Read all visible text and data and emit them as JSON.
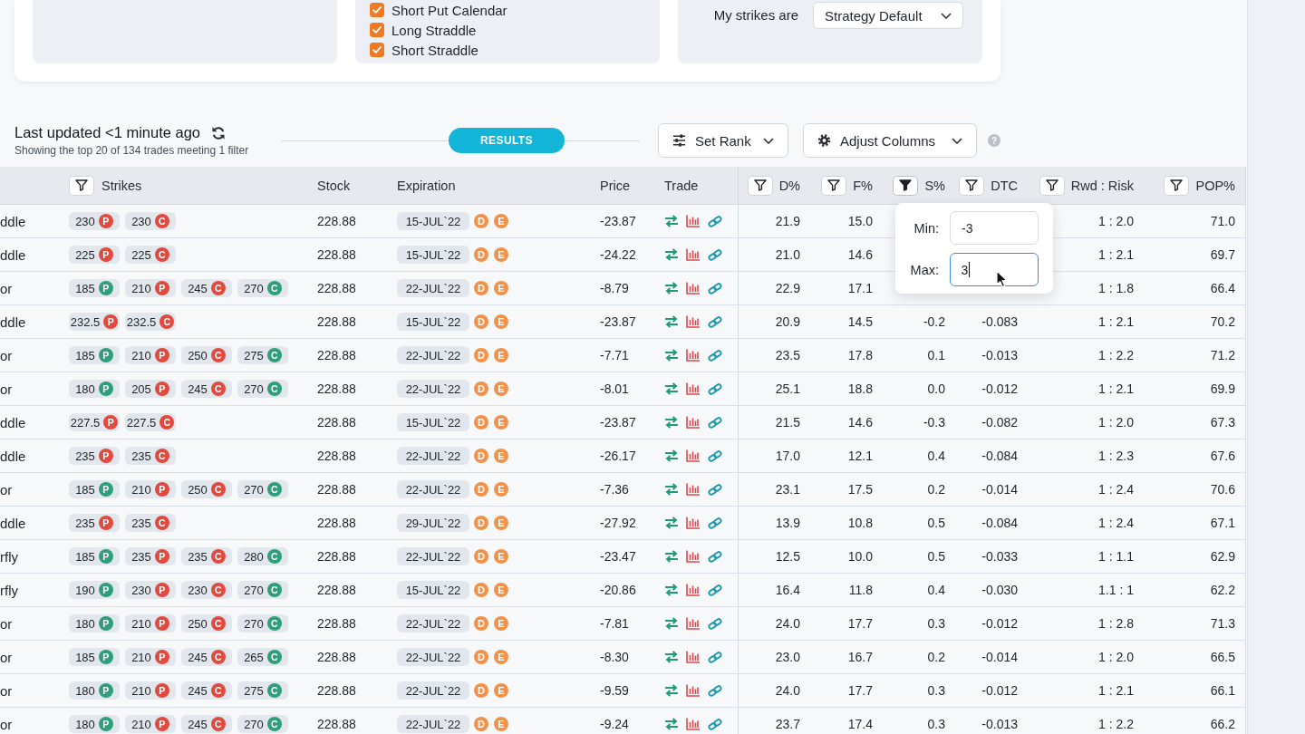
{
  "strategy_panel": {
    "cards": [
      {
        "kind": "blank"
      },
      {
        "kind": "checklist",
        "items": [
          {
            "label": "Short Put Calendar",
            "checked": true
          },
          {
            "label": "Long Straddle",
            "checked": true
          },
          {
            "label": "Short Straddle",
            "checked": true
          }
        ]
      },
      {
        "kind": "select",
        "label": "My strikes are",
        "value": "Strategy Default"
      }
    ]
  },
  "results_header": {
    "title": "Last updated <1 minute ago",
    "summary": "Showing the top 20 of 134 trades meeting 1 filter",
    "section_label": "RESULTS",
    "buttons": [
      {
        "kind": "rank",
        "label": "Set Rank"
      },
      {
        "kind": "columns",
        "label": "Adjust Columns"
      }
    ],
    "help": "?"
  },
  "table": {
    "columns": [
      {
        "label": "Strikes",
        "kind": "filterable",
        "filter_active": false
      },
      {
        "label": "Stock",
        "kind": "plain"
      },
      {
        "label": "Expiration",
        "kind": "plain"
      },
      {
        "label": "Price",
        "kind": "plain"
      },
      {
        "label": "Trade",
        "kind": "plain"
      },
      {
        "label": "D%",
        "kind": "filterable",
        "filter_active": false
      },
      {
        "label": "F%",
        "kind": "filterable",
        "filter_active": false
      },
      {
        "label": "S%",
        "kind": "filterable",
        "filter_active": true
      },
      {
        "label": "DTC",
        "kind": "filterable",
        "filter_active": false
      },
      {
        "label": "Rwd : Risk",
        "kind": "filterable",
        "filter_active": false
      },
      {
        "label": "POP%",
        "kind": "filterable",
        "filter_active": false
      }
    ],
    "rows": [
      {
        "strategy": "ddle",
        "strikes": [
          {
            "value": "230",
            "type": "P",
            "color": "#e04a3f"
          },
          {
            "value": "230",
            "type": "C",
            "color": "#e04a3f"
          }
        ],
        "stock": "228.88",
        "expiration": "15-JUL`22",
        "markers": [
          "D",
          "E"
        ],
        "price": "-23.87",
        "d_pct": "21.9",
        "f_pct": "15.0",
        "rwd_risk": "1 : 2.0",
        "pop_pct": "71.0"
      },
      {
        "strategy": "ddle",
        "strikes": [
          {
            "value": "225",
            "type": "P",
            "color": "#e04a3f"
          },
          {
            "value": "225",
            "type": "C",
            "color": "#e04a3f"
          }
        ],
        "stock": "228.88",
        "expiration": "15-JUL`22",
        "markers": [
          "D",
          "E"
        ],
        "price": "-24.22",
        "d_pct": "21.0",
        "f_pct": "14.6",
        "rwd_risk": "1 : 2.1",
        "pop_pct": "69.7"
      },
      {
        "strategy": "or",
        "strikes": [
          {
            "value": "185",
            "type": "P",
            "color": "#2f9e7b"
          },
          {
            "value": "210",
            "type": "P",
            "color": "#e04a3f"
          },
          {
            "value": "245",
            "type": "C",
            "color": "#e04a3f"
          },
          {
            "value": "270",
            "type": "C",
            "color": "#2f9e7b"
          }
        ],
        "stock": "228.88",
        "expiration": "22-JUL`22",
        "markers": [
          "D",
          "E"
        ],
        "price": "-8.79",
        "d_pct": "22.9",
        "f_pct": "17.1",
        "rwd_risk": "1 : 1.8",
        "pop_pct": "66.4"
      },
      {
        "strategy": "ddle",
        "strikes": [
          {
            "value": "232.5",
            "type": "P",
            "color": "#e04a3f"
          },
          {
            "value": "232.5",
            "type": "C",
            "color": "#e04a3f"
          }
        ],
        "stock": "228.88",
        "expiration": "15-JUL`22",
        "markers": [
          "D",
          "E"
        ],
        "price": "-23.87",
        "d_pct": "20.9",
        "f_pct": "14.5",
        "s_pct": "-0.2",
        "dtc": "-0.083",
        "rwd_risk": "1 : 2.1",
        "pop_pct": "70.2"
      },
      {
        "strategy": "or",
        "strikes": [
          {
            "value": "185",
            "type": "P",
            "color": "#2f9e7b"
          },
          {
            "value": "210",
            "type": "P",
            "color": "#e04a3f"
          },
          {
            "value": "250",
            "type": "C",
            "color": "#e04a3f"
          },
          {
            "value": "275",
            "type": "C",
            "color": "#2f9e7b"
          }
        ],
        "stock": "228.88",
        "expiration": "22-JUL`22",
        "markers": [
          "D",
          "E"
        ],
        "price": "-7.71",
        "d_pct": "23.5",
        "f_pct": "17.8",
        "s_pct": "0.1",
        "dtc": "-0.013",
        "rwd_risk": "1 : 2.2",
        "pop_pct": "71.2"
      },
      {
        "strategy": "or",
        "strikes": [
          {
            "value": "180",
            "type": "P",
            "color": "#2f9e7b"
          },
          {
            "value": "205",
            "type": "P",
            "color": "#e04a3f"
          },
          {
            "value": "245",
            "type": "C",
            "color": "#e04a3f"
          },
          {
            "value": "270",
            "type": "C",
            "color": "#2f9e7b"
          }
        ],
        "stock": "228.88",
        "expiration": "22-JUL`22",
        "markers": [
          "D",
          "E"
        ],
        "price": "-8.01",
        "d_pct": "25.1",
        "f_pct": "18.8",
        "s_pct": "0.0",
        "dtc": "-0.012",
        "rwd_risk": "1 : 2.1",
        "pop_pct": "69.9"
      },
      {
        "strategy": "ddle",
        "strikes": [
          {
            "value": "227.5",
            "type": "P",
            "color": "#e04a3f"
          },
          {
            "value": "227.5",
            "type": "C",
            "color": "#e04a3f"
          }
        ],
        "stock": "228.88",
        "expiration": "15-JUL`22",
        "markers": [
          "D",
          "E"
        ],
        "price": "-23.87",
        "d_pct": "21.5",
        "f_pct": "14.6",
        "s_pct": "-0.3",
        "dtc": "-0.082",
        "rwd_risk": "1 : 2.0",
        "pop_pct": "67.3"
      },
      {
        "strategy": "ddle",
        "strikes": [
          {
            "value": "235",
            "type": "P",
            "color": "#e04a3f"
          },
          {
            "value": "235",
            "type": "C",
            "color": "#e04a3f"
          }
        ],
        "stock": "228.88",
        "expiration": "22-JUL`22",
        "markers": [
          "D",
          "E"
        ],
        "price": "-26.17",
        "d_pct": "17.0",
        "f_pct": "12.1",
        "s_pct": "0.4",
        "dtc": "-0.084",
        "rwd_risk": "1 : 2.3",
        "pop_pct": "67.6"
      },
      {
        "strategy": "or",
        "strikes": [
          {
            "value": "185",
            "type": "P",
            "color": "#2f9e7b"
          },
          {
            "value": "210",
            "type": "P",
            "color": "#e04a3f"
          },
          {
            "value": "250",
            "type": "C",
            "color": "#e04a3f"
          },
          {
            "value": "270",
            "type": "C",
            "color": "#2f9e7b"
          }
        ],
        "stock": "228.88",
        "expiration": "22-JUL`22",
        "markers": [
          "D",
          "E"
        ],
        "price": "-7.36",
        "d_pct": "23.1",
        "f_pct": "17.5",
        "s_pct": "0.2",
        "dtc": "-0.014",
        "rwd_risk": "1 : 2.4",
        "pop_pct": "70.6"
      },
      {
        "strategy": "ddle",
        "strikes": [
          {
            "value": "235",
            "type": "P",
            "color": "#e04a3f"
          },
          {
            "value": "235",
            "type": "C",
            "color": "#e04a3f"
          }
        ],
        "stock": "228.88",
        "expiration": "29-JUL`22",
        "markers": [
          "D",
          "E"
        ],
        "price": "-27.92",
        "d_pct": "13.9",
        "f_pct": "10.8",
        "s_pct": "0.5",
        "dtc": "-0.084",
        "rwd_risk": "1 : 2.4",
        "pop_pct": "67.1"
      },
      {
        "strategy": "rfly",
        "strikes": [
          {
            "value": "185",
            "type": "P",
            "color": "#2f9e7b"
          },
          {
            "value": "235",
            "type": "P",
            "color": "#e04a3f"
          },
          {
            "value": "235",
            "type": "C",
            "color": "#e04a3f"
          },
          {
            "value": "280",
            "type": "C",
            "color": "#2f9e7b"
          }
        ],
        "stock": "228.88",
        "expiration": "22-JUL`22",
        "markers": [
          "D",
          "E"
        ],
        "price": "-23.47",
        "d_pct": "12.5",
        "f_pct": "10.0",
        "s_pct": "0.5",
        "dtc": "-0.033",
        "rwd_risk": "1 : 1.1",
        "pop_pct": "62.9"
      },
      {
        "strategy": "rfly",
        "strikes": [
          {
            "value": "190",
            "type": "P",
            "color": "#2f9e7b"
          },
          {
            "value": "230",
            "type": "P",
            "color": "#e04a3f"
          },
          {
            "value": "230",
            "type": "C",
            "color": "#e04a3f"
          },
          {
            "value": "270",
            "type": "C",
            "color": "#2f9e7b"
          }
        ],
        "stock": "228.88",
        "expiration": "15-JUL`22",
        "markers": [
          "D",
          "E"
        ],
        "price": "-20.86",
        "d_pct": "16.4",
        "f_pct": "11.8",
        "s_pct": "0.4",
        "dtc": "-0.030",
        "rwd_risk": "1.1 : 1",
        "pop_pct": "62.2"
      },
      {
        "strategy": "or",
        "strikes": [
          {
            "value": "180",
            "type": "P",
            "color": "#2f9e7b"
          },
          {
            "value": "210",
            "type": "P",
            "color": "#e04a3f"
          },
          {
            "value": "250",
            "type": "C",
            "color": "#e04a3f"
          },
          {
            "value": "270",
            "type": "C",
            "color": "#2f9e7b"
          }
        ],
        "stock": "228.88",
        "expiration": "22-JUL`22",
        "markers": [
          "D",
          "E"
        ],
        "price": "-7.81",
        "d_pct": "24.0",
        "f_pct": "17.7",
        "s_pct": "0.3",
        "dtc": "-0.012",
        "rwd_risk": "1 : 2.8",
        "pop_pct": "71.3"
      },
      {
        "strategy": "or",
        "strikes": [
          {
            "value": "185",
            "type": "P",
            "color": "#2f9e7b"
          },
          {
            "value": "210",
            "type": "P",
            "color": "#e04a3f"
          },
          {
            "value": "245",
            "type": "C",
            "color": "#e04a3f"
          },
          {
            "value": "265",
            "type": "C",
            "color": "#2f9e7b"
          }
        ],
        "stock": "228.88",
        "expiration": "22-JUL`22",
        "markers": [
          "D",
          "E"
        ],
        "price": "-8.30",
        "d_pct": "23.0",
        "f_pct": "16.7",
        "s_pct": "0.2",
        "dtc": "-0.014",
        "rwd_risk": "1 : 2.0",
        "pop_pct": "66.5"
      },
      {
        "strategy": "or",
        "strikes": [
          {
            "value": "180",
            "type": "P",
            "color": "#2f9e7b"
          },
          {
            "value": "210",
            "type": "P",
            "color": "#e04a3f"
          },
          {
            "value": "245",
            "type": "C",
            "color": "#e04a3f"
          },
          {
            "value": "275",
            "type": "C",
            "color": "#2f9e7b"
          }
        ],
        "stock": "228.88",
        "expiration": "22-JUL`22",
        "markers": [
          "D",
          "E"
        ],
        "price": "-9.59",
        "d_pct": "24.0",
        "f_pct": "17.7",
        "s_pct": "0.3",
        "dtc": "-0.012",
        "rwd_risk": "1 : 2.1",
        "pop_pct": "66.1"
      },
      {
        "strategy": "or",
        "strikes": [
          {
            "value": "180",
            "type": "P",
            "color": "#2f9e7b"
          },
          {
            "value": "210",
            "type": "P",
            "color": "#e04a3f"
          },
          {
            "value": "245",
            "type": "C",
            "color": "#e04a3f"
          },
          {
            "value": "270",
            "type": "C",
            "color": "#2f9e7b"
          }
        ],
        "stock": "228.88",
        "expiration": "22-JUL`22",
        "markers": [
          "D",
          "E"
        ],
        "price": "-9.24",
        "d_pct": "23.7",
        "f_pct": "17.4",
        "s_pct": "0.3",
        "dtc": "-0.013",
        "rwd_risk": "1 : 2.2",
        "pop_pct": "66.2"
      }
    ]
  },
  "filter_popup": {
    "fields": [
      {
        "label": "Min:",
        "value": "-3",
        "focused": false
      },
      {
        "label": "Max:",
        "value": "3",
        "focused": true
      }
    ]
  }
}
